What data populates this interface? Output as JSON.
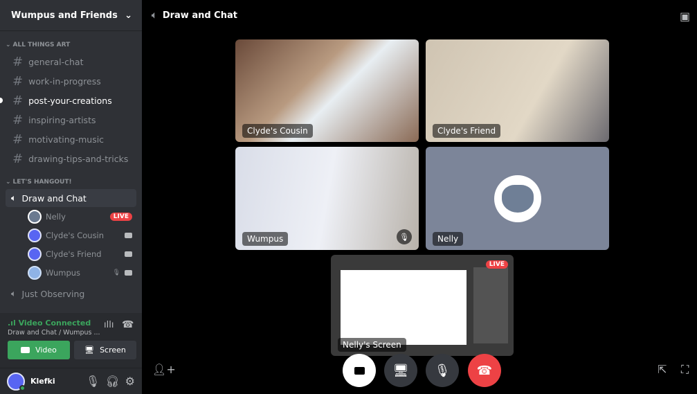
{
  "server": {
    "name": "Wumpus and Friends"
  },
  "categories": [
    {
      "label": "ALL THINGS ART",
      "channels": [
        {
          "name": "general-chat"
        },
        {
          "name": "work-in-progress"
        },
        {
          "name": "post-your-creations",
          "active": true
        },
        {
          "name": "inspiring-artists"
        },
        {
          "name": "motivating-music"
        },
        {
          "name": "drawing-tips-and-tricks"
        }
      ]
    },
    {
      "label": "LET'S HANGOUT!",
      "voice_channels": [
        {
          "name": "Draw and Chat"
        },
        {
          "name": "Just Observing"
        }
      ]
    }
  ],
  "voice_users": [
    {
      "name": "Nelly",
      "badge": "LIVE"
    },
    {
      "name": "Clyde's Cousin",
      "icon": "camera-icon"
    },
    {
      "name": "Clyde's Friend",
      "icon": "camera-icon"
    },
    {
      "name": "Wumpus",
      "icon": "camera-icon",
      "muted": true
    }
  ],
  "voice_status": {
    "status": "Video Connected",
    "location": "Draw and Chat / Wumpus ...",
    "video_label": "Video",
    "screen_label": "Screen"
  },
  "current_user": {
    "name": "Klefki"
  },
  "main": {
    "title": "Draw and Chat",
    "tiles": [
      {
        "label": "Clyde's Cousin"
      },
      {
        "label": "Clyde's Friend"
      },
      {
        "label": "Wumpus"
      },
      {
        "label": "Nelly"
      }
    ],
    "screen_share": {
      "label": "Nelly's Screen",
      "badge": "LIVE"
    }
  },
  "colors": {
    "green": "#3ba55d",
    "red": "#ed4245",
    "sidebar": "#2f3136"
  }
}
